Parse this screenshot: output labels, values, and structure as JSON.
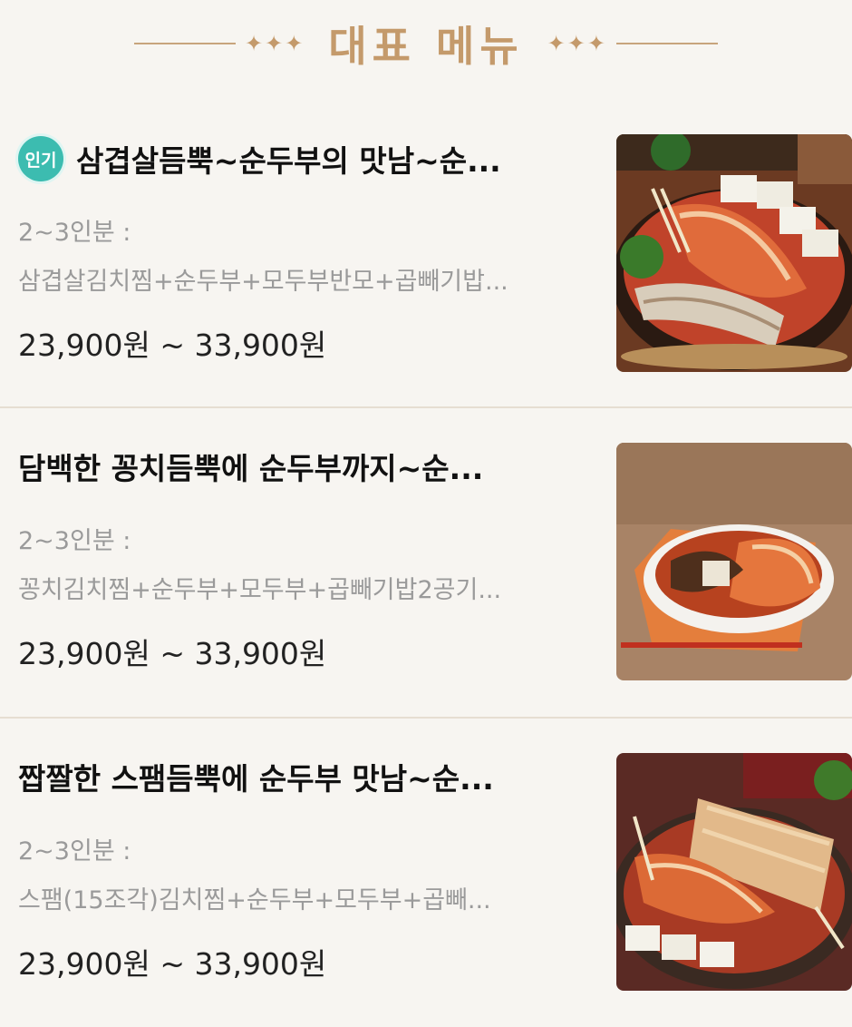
{
  "header": {
    "title": "대표 메뉴",
    "ornament_left": "✦✦✦",
    "ornament_right": "✦✦✦"
  },
  "menu": {
    "items": [
      {
        "badge": "인기",
        "title": "삼겹살듬뿍~순두부의 맛남~순...",
        "serving": "2~3인분 :",
        "description": "삼겹살김치찜+순두부+모두부반모+곱빼기밥...",
        "price": "23,900원 ~ 33,900원",
        "image_icon": "pork-kimchi-stew-photo"
      },
      {
        "title": "담백한 꽁치듬뿍에 순두부까지~순...",
        "serving": "2~3인분 :",
        "description": "꽁치김치찜+순두부+모두부+곱빼기밥2공기...",
        "price": "23,900원 ~ 33,900원",
        "image_icon": "saury-kimchi-stew-photo"
      },
      {
        "title": "짭짤한 스팸듬뿍에 순두부 맛남~순...",
        "serving": "2~3인분 :",
        "description": "스팸(15조각)김치찜+순두부+모두부+곱빼...",
        "price": "23,900원 ~ 33,900원",
        "image_icon": "spam-kimchi-stew-photo"
      }
    ]
  },
  "colors": {
    "accent_gold": "#c49a6b",
    "badge_teal": "#3cbcb0",
    "background": "#f7f5f1"
  }
}
